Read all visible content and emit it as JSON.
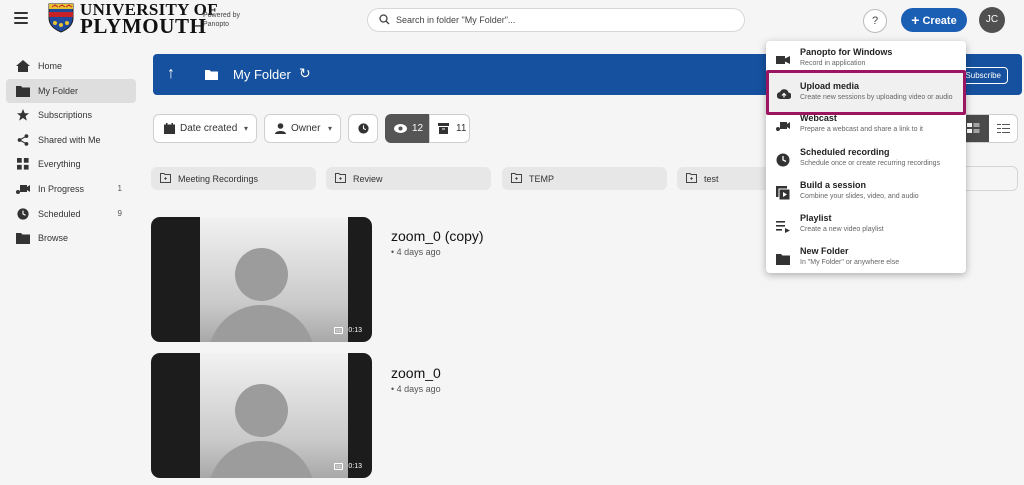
{
  "header": {
    "uni_line1": "UNIVERSITY OF",
    "uni_line2": "PLYMOUTH",
    "powered_line1": "Powered by",
    "powered_line2": "Panopto",
    "search_placeholder": "Search in folder \"My Folder\"...",
    "help_label": "?",
    "create_label": "Create",
    "avatar_initials": "JC"
  },
  "sidebar": {
    "items": [
      {
        "label": "Home",
        "icon": "home-icon"
      },
      {
        "label": "My Folder",
        "icon": "folder-icon"
      },
      {
        "label": "Subscriptions",
        "icon": "star-icon"
      },
      {
        "label": "Shared with Me",
        "icon": "share-icon"
      },
      {
        "label": "Everything",
        "icon": "grid-icon"
      },
      {
        "label": "In Progress",
        "icon": "webcam-icon",
        "count": "1"
      },
      {
        "label": "Scheduled",
        "icon": "clock-icon",
        "count": "9"
      },
      {
        "label": "Browse",
        "icon": "folder-icon"
      }
    ]
  },
  "banner": {
    "title": "My Folder",
    "subscribe_label": "Subscribe"
  },
  "filters": {
    "date_label": "Date created",
    "owner_label": "Owner",
    "views_count": "12",
    "archive_count": "11"
  },
  "folders": [
    "Meeting Recordings",
    "Review",
    "TEMP",
    "test"
  ],
  "sessions": [
    {
      "title": "zoom_0 (copy)",
      "date": "• 4 days ago",
      "duration": "0:13"
    },
    {
      "title": "zoom_0",
      "date": "• 4 days ago",
      "duration": "0:13"
    }
  ],
  "create_menu": [
    {
      "title": "Panopto for Windows",
      "subtitle": "Record in application",
      "icon": "video-camera-icon"
    },
    {
      "title": "Upload media",
      "subtitle": "Create new sessions by uploading video or audio",
      "icon": "cloud-upload-icon",
      "highlighted": true
    },
    {
      "title": "Webcast",
      "subtitle": "Prepare a webcast and share a link to it",
      "icon": "webcast-icon"
    },
    {
      "title": "Scheduled recording",
      "subtitle": "Schedule once or create recurring recordings",
      "icon": "clock-icon"
    },
    {
      "title": "Build a session",
      "subtitle": "Combine your slides, video, and audio",
      "icon": "build-session-icon"
    },
    {
      "title": "Playlist",
      "subtitle": "Create a new video playlist",
      "icon": "playlist-icon"
    },
    {
      "title": "New Folder",
      "subtitle": "In \"My Folder\" or anywhere else",
      "icon": "folder-icon"
    }
  ],
  "colors": {
    "brand_blue": "#15519e",
    "create_blue": "#1a5fb4",
    "highlight_border": "#9b1560"
  }
}
